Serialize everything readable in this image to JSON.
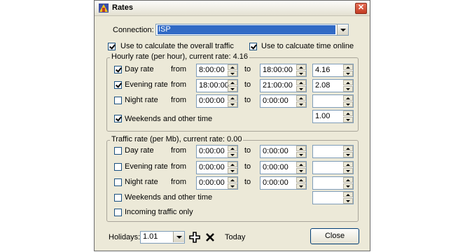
{
  "window": {
    "title": "Rates",
    "close_glyph": "✕"
  },
  "connection": {
    "label": "Connection:",
    "value": "ISP"
  },
  "options": {
    "overall_traffic": {
      "label": "Use to calculate the overall traffic",
      "checked": true
    },
    "time_online": {
      "label": "Use to calcuate time online",
      "checked": true
    }
  },
  "hourly": {
    "title": "Hourly rate (per hour), current rate: 4.16",
    "from_label": "from",
    "to_label": "to",
    "rows": [
      {
        "label": "Day rate",
        "checked": true,
        "from": "8:00:00",
        "to": "18:00:00",
        "rate": "4.16"
      },
      {
        "label": "Evening rate",
        "checked": true,
        "from": "18:00:00",
        "to": "21:00:00",
        "rate": "2.08"
      },
      {
        "label": "Night rate",
        "checked": false,
        "from": "0:00:00",
        "to": "0:00:00",
        "rate": ""
      }
    ],
    "weekends": {
      "label": "Weekends and other time",
      "checked": true,
      "rate": "1.00"
    }
  },
  "traffic": {
    "title": "Traffic rate (per Mb), current rate: 0.00",
    "from_label": "from",
    "to_label": "to",
    "rows": [
      {
        "label": "Day rate",
        "checked": false,
        "from": "0:00:00",
        "to": "0:00:00",
        "rate": ""
      },
      {
        "label": "Evening rate",
        "checked": false,
        "from": "0:00:00",
        "to": "0:00:00",
        "rate": ""
      },
      {
        "label": "Night rate",
        "checked": false,
        "from": "0:00:00",
        "to": "0:00:00",
        "rate": ""
      }
    ],
    "weekends": {
      "label": "Weekends and other time",
      "checked": false,
      "rate": ""
    },
    "incoming": {
      "label": "Incoming traffic only",
      "checked": false
    }
  },
  "footer": {
    "holidays_label": "Holidays:",
    "holidays_value": "1.01",
    "add_icon": "add-icon",
    "delete_icon": "delete-icon",
    "today_label": "Today",
    "close_label": "Close"
  }
}
